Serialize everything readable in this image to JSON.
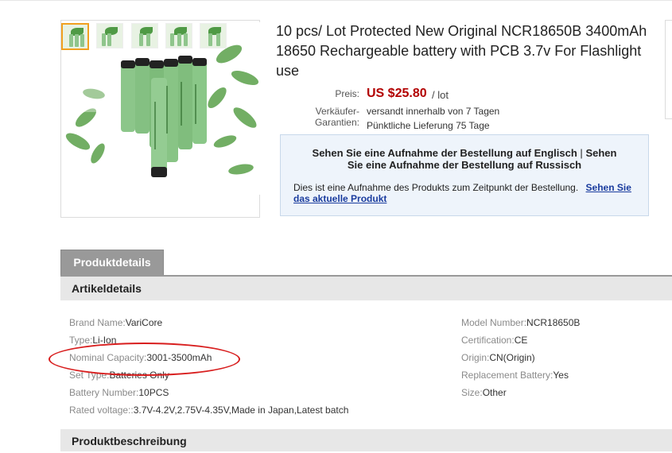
{
  "product": {
    "title": "10 pcs/ Lot Protected New Original NCR18650B 3400mAh 18650 Rechargeable battery with PCB 3.7v For Flashlight use",
    "price_label": "Preis:",
    "price": "US $25.80",
    "price_unit": "/ lot",
    "shipping_label_1": "Verkäufer-",
    "shipping_label_2": "Garantien:",
    "shipping_value_1": "versandt innerhalb von 7 Tagen",
    "shipping_value_2": "Pünktliche Lieferung 75 Tage"
  },
  "notice": {
    "line1_a": "Sehen Sie eine Aufnahme der Bestellung auf Englisch",
    "line1_sep": "|",
    "line1_b": "Sehen",
    "line2": "Sie eine Aufnahme der Bestellung auf Russisch",
    "body_text": "Dies ist eine Aufnahme des Produkts zum Zeitpunkt der Bestellung.",
    "link_text": "Sehen Sie das aktuelle Produkt"
  },
  "tabs": {
    "details": "Produktdetails"
  },
  "sections": {
    "item_details": "Artikeldetails",
    "description": "Produktbeschreibung"
  },
  "attributes_left": [
    {
      "key": "Brand Name:",
      "value": "VariCore"
    },
    {
      "key": "Type:",
      "value": "Li-Ion"
    },
    {
      "key": "Nominal Capacity:",
      "value": "3001-3500mAh"
    },
    {
      "key": "Set Type:",
      "value": "Batteries Only"
    },
    {
      "key": "Battery Number:",
      "value": "10PCS"
    },
    {
      "key": "Rated voltage::",
      "value": "3.7V-4.2V,2.75V-4.35V,Made in Japan,Latest batch"
    }
  ],
  "attributes_right": [
    {
      "key": "Model Number:",
      "value": "NCR18650B"
    },
    {
      "key": "Certification:",
      "value": "CE"
    },
    {
      "key": "Origin:",
      "value": "CN(Origin)"
    },
    {
      "key": "Replacement Battery:",
      "value": "Yes"
    },
    {
      "key": "Size:",
      "value": "Other"
    }
  ],
  "colors": {
    "price": "#b20000",
    "link": "#1a3c9e",
    "highlight_circle": "#d81e1e",
    "thumb_active": "#f0a020"
  }
}
